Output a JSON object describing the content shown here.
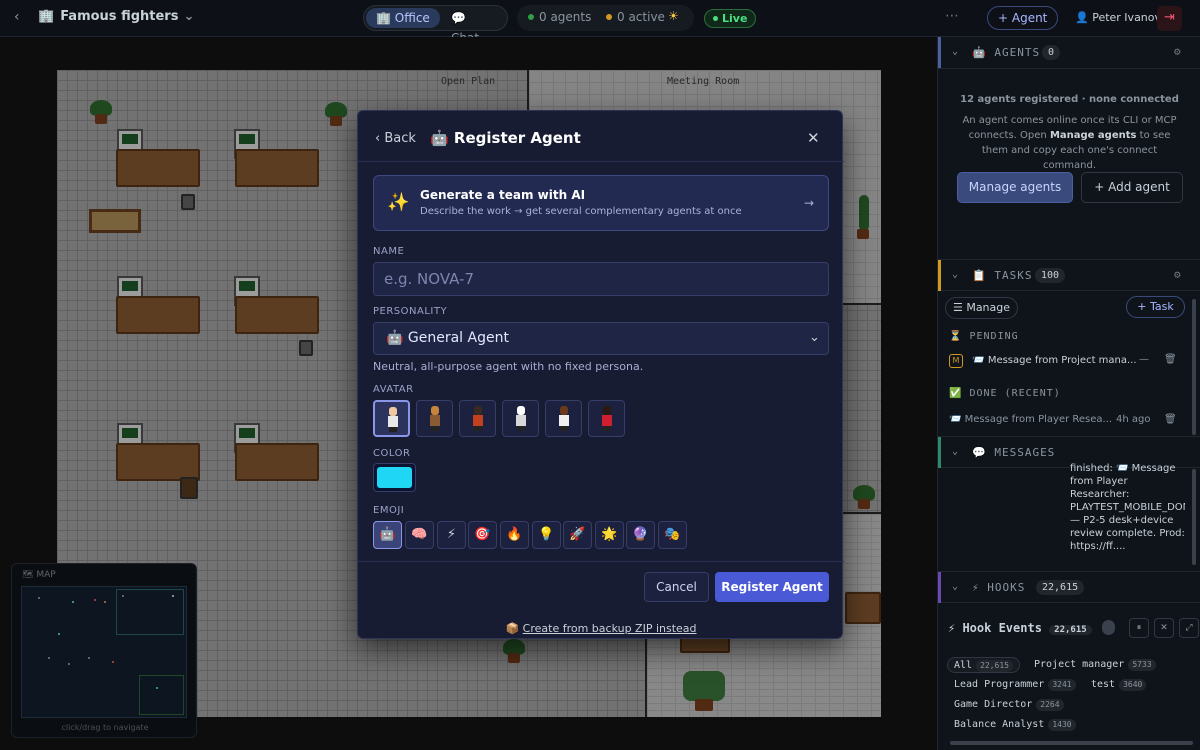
{
  "topbar": {
    "back_icon": "chevron-left-icon",
    "title": "Famous fighters",
    "title_icon": "building-icon",
    "tabs": [
      {
        "label": "Office",
        "icon": "building-icon",
        "active": true
      },
      {
        "label": "Chat",
        "icon": "speech-bubble-icon",
        "active": false
      }
    ],
    "stats": {
      "agents": "0 agents",
      "active": "0 active"
    },
    "weather_icon": "sun-icon",
    "live_label": "Live",
    "more_icon": "ellipsis-icon",
    "add_agent_label": "+ Agent",
    "user_name": "Peter Ivanov",
    "logout_icon": "logout-icon",
    "colors": {
      "live": "#4ade80",
      "accent": "#4a5ad6"
    }
  },
  "map": {
    "rooms": {
      "open_plan": "Open Plan",
      "meeting_room": "Meeting Room"
    },
    "minimap": {
      "title": "MAP",
      "hint": "click/drag to navigate"
    }
  },
  "modal": {
    "back_label": "Back",
    "title": "Register Agent",
    "title_icon": "robot-icon",
    "close_icon": "close-icon",
    "generate": {
      "title": "Generate a team with AI",
      "subtitle": "Describe the work → get several complementary agents at once",
      "icon": "sparkles-icon",
      "arrow": "→"
    },
    "name_label": "NAME",
    "name_value": "",
    "name_placeholder": "e.g. NOVA-7",
    "personality_label": "PERSONALITY",
    "personality_value": "🤖 General Agent",
    "personality_hint": "Neutral, all-purpose agent with no fixed persona.",
    "avatar_label": "AVATAR",
    "avatars": [
      {
        "selected": true
      },
      {
        "selected": false
      },
      {
        "selected": false
      },
      {
        "selected": false
      },
      {
        "selected": false
      },
      {
        "selected": false
      }
    ],
    "color_label": "COLOR",
    "color_value": "#1fd6f5",
    "emoji_label": "EMOJI",
    "emojis": [
      "🤖",
      "🧠",
      "⚡",
      "🎯",
      "🔥",
      "💡",
      "🚀",
      "🌟",
      "🔮",
      "🎭"
    ],
    "selected_emoji": "🤖",
    "cancel_label": "Cancel",
    "register_label": "Register Agent",
    "backup_icon": "package-icon",
    "backup_link": "Create from backup ZIP instead"
  },
  "sidebar": {
    "agents": {
      "title": "AGENTS",
      "count": "0",
      "registered": "12 agents registered · none connected",
      "desc_before": "An agent comes online once its CLI or MCP connects. Open ",
      "desc_bold": "Manage agents",
      "desc_after": " to see them and copy each one's connect command.",
      "manage_label": "Manage agents",
      "add_label": "+ Add agent"
    },
    "tasks": {
      "title": "TASKS",
      "count": "100",
      "manage_label": "☰ Manage",
      "add_label": "+ Task",
      "pending_label": "PENDING",
      "pending_items": [
        {
          "avatar": "M",
          "text": "📨 Message from Project mana...",
          "status": "—"
        }
      ],
      "done_label": "DONE (RECENT)",
      "done_items": [
        {
          "text": "📨 Message from Player Resea...",
          "time": "4h ago"
        }
      ]
    },
    "messages": {
      "title": "MESSAGES",
      "preview": "finished: 📨 Message from Player Researcher: PLAYTEST_MOBILE_DONE — P2-5 desk+device review complete. Prod: https://ff...."
    },
    "hooks": {
      "title": "HOOKS",
      "count": "22,615",
      "events_title": "⚡ Hook Events",
      "events_count": "22,615",
      "filters": [
        {
          "label": "All",
          "count": "22,615",
          "active": true
        },
        {
          "label": "Project manager",
          "count": "5733"
        },
        {
          "label": "Lead Programmer",
          "count": "3241"
        },
        {
          "label": "test",
          "count": "3640"
        },
        {
          "label": "Game Director",
          "count": "2264"
        },
        {
          "label": "Balance Analyst",
          "count": "1430"
        }
      ]
    }
  }
}
